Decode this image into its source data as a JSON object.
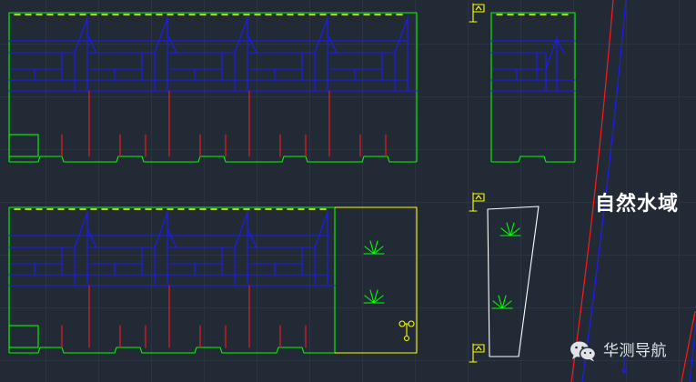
{
  "viewport": {
    "background": "#222a35",
    "grid_color": "#2c3441"
  },
  "colors": {
    "green": "#00ff00",
    "blue": "#1c1cff",
    "red": "#ff1a1a",
    "yellow": "#ffff00",
    "white": "#ffffff"
  },
  "labels": {
    "water_area": "自然水域"
  },
  "symbols": {
    "flag": "flag-marker-icon",
    "grass": "grass-symbol-icon",
    "lamp": "lamp-symbol-icon"
  },
  "watermark": {
    "icon": "wechat-icon",
    "text": "华测导航",
    "color": "#dfe3e8"
  }
}
